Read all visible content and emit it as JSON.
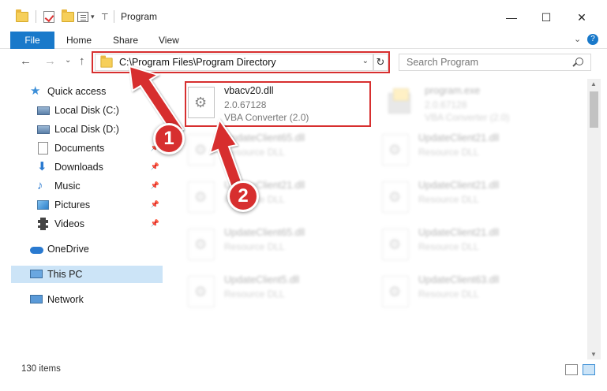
{
  "window": {
    "title": "Program",
    "minimize": "—",
    "maximize": "☐",
    "close": "✕"
  },
  "ribbon": {
    "tabs": [
      "File",
      "Home",
      "Share",
      "View"
    ],
    "expand": "⌄",
    "help": "?"
  },
  "navigation": {
    "back": "←",
    "forward": "→",
    "recent": "⌄",
    "up": "↑",
    "address": "C:\\Program Files\\Program Directory",
    "address_dropdown": "⌄",
    "refresh": "↻",
    "search_placeholder": "Search Program"
  },
  "sidebar": {
    "items": [
      {
        "label": "Quick access",
        "icon": "star-icon",
        "pinned": false
      },
      {
        "label": "Local Disk (C:)",
        "icon": "disk-icon",
        "pinned": true
      },
      {
        "label": "Local Disk (D:)",
        "icon": "disk-icon",
        "pinned": true
      },
      {
        "label": "Documents",
        "icon": "document-icon",
        "pinned": true
      },
      {
        "label": "Downloads",
        "icon": "download-icon",
        "pinned": true
      },
      {
        "label": "Music",
        "icon": "music-icon",
        "pinned": true
      },
      {
        "label": "Pictures",
        "icon": "pictures-icon",
        "pinned": true
      },
      {
        "label": "Videos",
        "icon": "videos-icon",
        "pinned": true
      },
      {
        "label": "OneDrive",
        "icon": "cloud-icon",
        "pinned": false
      },
      {
        "label": "This PC",
        "icon": "computer-icon",
        "pinned": false,
        "selected": true
      },
      {
        "label": "Network",
        "icon": "network-icon",
        "pinned": false
      }
    ]
  },
  "files": [
    {
      "name": "vbacv20.dll",
      "line2": "2.0.67128",
      "line3": "VBA Converter (2.0)",
      "highlighted": true
    },
    {
      "name": "program.exe",
      "line2": "2.0.67128",
      "line3": "VBA Converter (2.0)",
      "highlighted": false
    },
    {
      "name": "UpdateClient65.dll",
      "line2": "Resource DLL",
      "highlighted": false
    },
    {
      "name": "UpdateClient21.dll",
      "line2": "Resource DLL",
      "highlighted": false
    },
    {
      "name": "UpdateClient21.dll",
      "line2": "Resource DLL",
      "highlighted": false
    },
    {
      "name": "UpdateClient21.dll",
      "line2": "Resource DLL",
      "highlighted": false
    },
    {
      "name": "UpdateClient65.dll",
      "line2": "Resource DLL",
      "highlighted": false
    },
    {
      "name": "UpdateClient21.dll",
      "line2": "Resource DLL",
      "highlighted": false
    },
    {
      "name": "UpdateClient5.dll",
      "line2": "Resource DLL",
      "highlighted": false
    },
    {
      "name": "UpdateClient63.dll",
      "line2": "Resource DLL",
      "highlighted": false
    }
  ],
  "status": {
    "item_count": "130 items"
  },
  "annotations": {
    "step1": "1",
    "step2": "2",
    "color": "#d72f2f"
  },
  "colors": {
    "accent": "#1979ca",
    "selection": "#cce4f7"
  }
}
